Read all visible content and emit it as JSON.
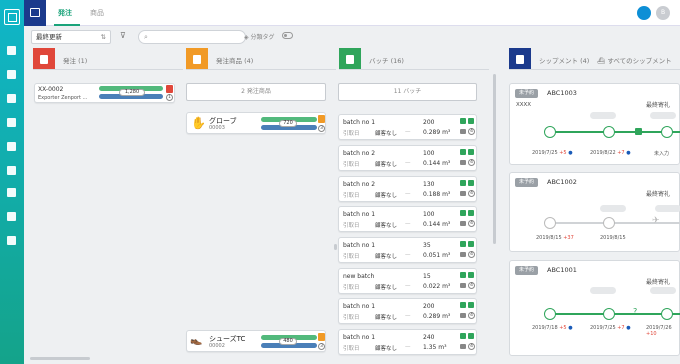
{
  "topbar": {
    "tabs": [
      {
        "label": "発注"
      },
      {
        "label": "商品"
      }
    ],
    "avatar_initial": "B"
  },
  "filter": {
    "sort_value": "最終更新",
    "search_placeholder": "",
    "tag_filter_label": "分類タグ"
  },
  "columns": [
    {
      "label": "発注 (1)",
      "color": "#e0473a"
    },
    {
      "label": "発注商品 (4)",
      "color": "#f19a26"
    },
    {
      "label": "バッチ (16)",
      "color": "#2fa55b"
    },
    {
      "label": "シップメント (4)",
      "color": "#1b3a8c"
    }
  ],
  "all_shipments_label": "すべてのシップメント",
  "order": {
    "id": "XX-0002",
    "exporter": "Exporter Zenport ...",
    "qty": "1,280"
  },
  "order_items_button": "2 発注商品",
  "batches_button": "11 バッチ",
  "products": [
    {
      "name": "グローブ",
      "code": "00003",
      "qty": "720",
      "badge": "3"
    },
    {
      "name": "シューズTC",
      "code": "00002",
      "qty": "480",
      "badge": "3"
    }
  ],
  "batches": [
    {
      "name": "batch no 1",
      "quantity": "200",
      "volume": "0.289 m³",
      "label_a": "引取日",
      "label_b": "顧客なし",
      "badge": "4"
    },
    {
      "name": "batch no 2",
      "quantity": "100",
      "volume": "0.144 m³",
      "label_a": "引取日",
      "label_b": "顧客なし",
      "badge": "4"
    },
    {
      "name": "batch no 2",
      "quantity": "130",
      "volume": "0.188 m³",
      "label_a": "引取日",
      "label_b": "顧客なし",
      "badge": "4"
    },
    {
      "name": "batch no 1",
      "quantity": "100",
      "volume": "0.144 m³",
      "label_a": "引取日",
      "label_b": "顧客なし",
      "badge": "4"
    },
    {
      "name": "batch no 1",
      "quantity": "35",
      "volume": "0.051 m³",
      "label_a": "引取日",
      "label_b": "顧客なし",
      "badge": "4"
    },
    {
      "name": "new batch",
      "quantity": "15",
      "volume": "0.022 m³",
      "label_a": "引取日",
      "label_b": "顧客なし",
      "badge": "4"
    },
    {
      "name": "batch no 1",
      "quantity": "200",
      "volume": "0.289 m³",
      "label_a": "引取日",
      "label_b": "顧客なし",
      "badge": "4"
    },
    {
      "name": "batch no 1",
      "quantity": "240",
      "volume": "1.35 m³",
      "label_a": "引取日",
      "label_b": "顧客なし",
      "badge": "4"
    }
  ],
  "shipments": [
    {
      "status": "未予約",
      "id": "ABC1003",
      "extra": "XXXX",
      "last_label": "最終寄礼",
      "dates": [
        "2019/7/25",
        "2019/8/22"
      ],
      "offsets": [
        "+5",
        "+7"
      ],
      "mid_label": "未入力"
    },
    {
      "status": "未予約",
      "id": "ABC1002",
      "extra": "",
      "last_label": "最終寄礼",
      "dates": [
        "2019/8/15",
        "2019/8/15"
      ],
      "offsets": [
        "+37",
        ""
      ],
      "mid_label": ""
    },
    {
      "status": "未予約",
      "id": "ABC1001",
      "extra": "",
      "last_label": "最終寄礼",
      "dates": [
        "2019/7/18",
        "2019/7/25",
        "2019/7/26"
      ],
      "offsets": [
        "+5",
        "+7",
        "+10"
      ],
      "mid_label": ""
    }
  ]
}
